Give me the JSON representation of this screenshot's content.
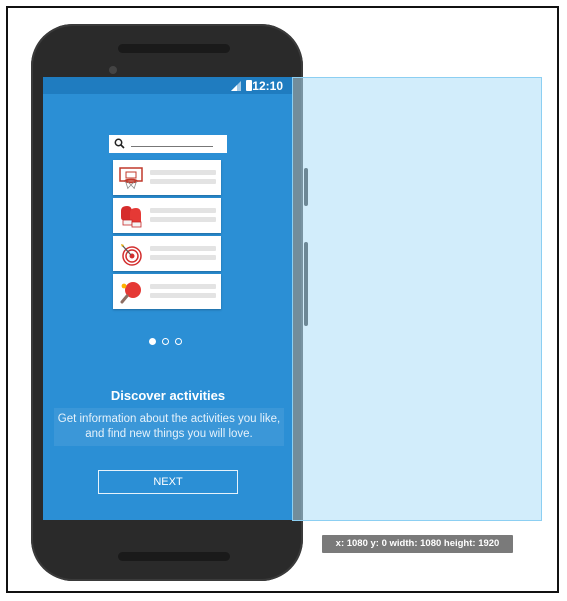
{
  "status_bar": {
    "time": "12:10"
  },
  "onboarding": {
    "title": "Discover activities",
    "description_line1": "Get information about the activities you like,",
    "description_line2": "and find new things you will love.",
    "next_label": "NEXT",
    "page_count": 3,
    "active_page": 1,
    "activities": [
      {
        "icon": "basketball-hoop-icon"
      },
      {
        "icon": "boxing-gloves-icon"
      },
      {
        "icon": "darts-target-icon"
      },
      {
        "icon": "table-tennis-icon"
      }
    ]
  },
  "overlay": {
    "coords_label": "x: 1080  y: 0  width: 1080  height: 1920"
  },
  "colors": {
    "screen_bg": "#2b8fd5",
    "status_bar_bg": "#1f7cc0",
    "overlay_fill": "#addef8"
  }
}
